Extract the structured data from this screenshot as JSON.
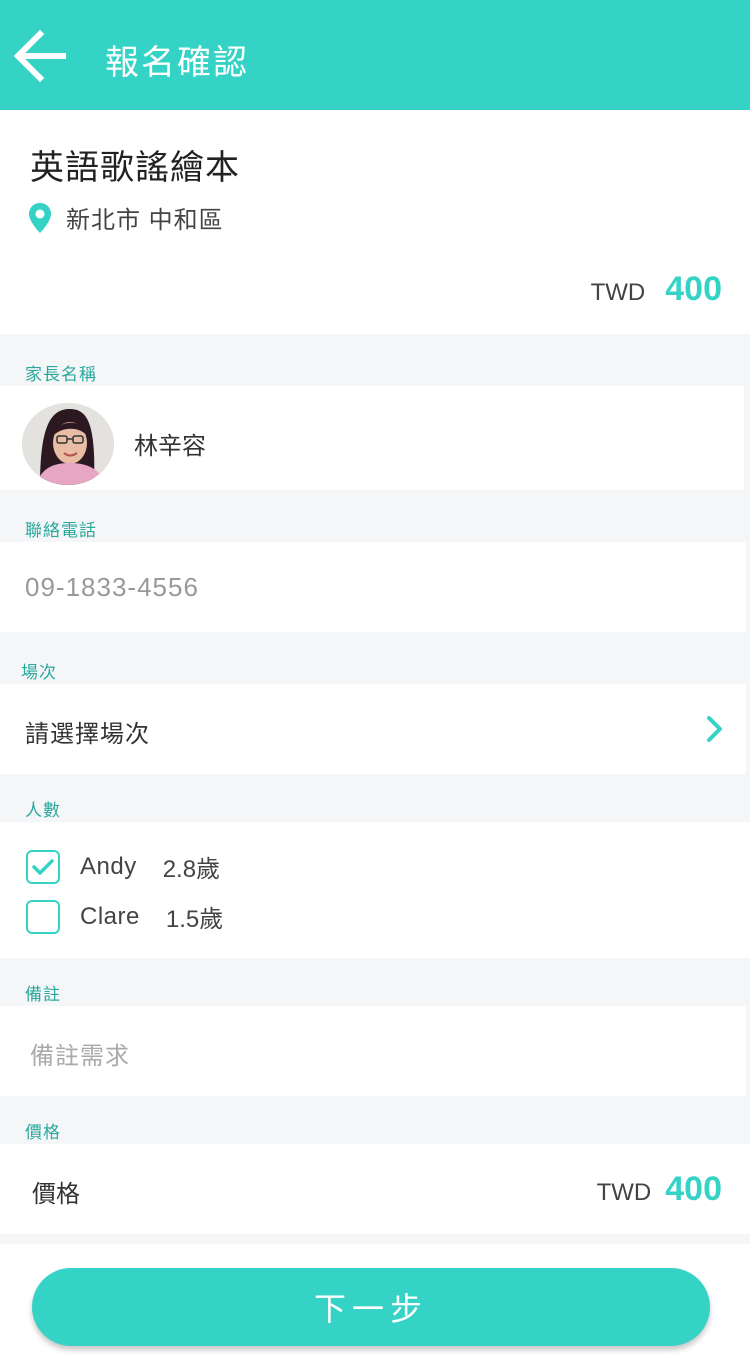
{
  "header": {
    "title": "報名確認",
    "back_icon": "arrow-left-icon"
  },
  "event": {
    "title": "英語歌謠繪本",
    "location": "新北市 中和區",
    "currency": "TWD",
    "price": "400"
  },
  "sections": {
    "parent_label": "家長名稱",
    "phone_label": "聯絡電話",
    "session_label": "場次",
    "people_label": "人數",
    "note_label": "備註",
    "price_label": "價格"
  },
  "parent": {
    "name": "林辛容"
  },
  "phone": {
    "value": "09-1833-4556"
  },
  "session": {
    "placeholder": "請選擇場次"
  },
  "children": [
    {
      "name": "Andy",
      "age": "2.8歲",
      "checked": true
    },
    {
      "name": "Clare",
      "age": "1.5歲",
      "checked": false
    }
  ],
  "note": {
    "placeholder": "備註需求"
  },
  "price_row": {
    "label": "價格",
    "currency": "TWD",
    "value": "400"
  },
  "footer": {
    "next_label": "下一步"
  },
  "colors": {
    "accent": "#35d3c6",
    "label_text": "#2aa89d",
    "background": "#f5f6f8"
  }
}
